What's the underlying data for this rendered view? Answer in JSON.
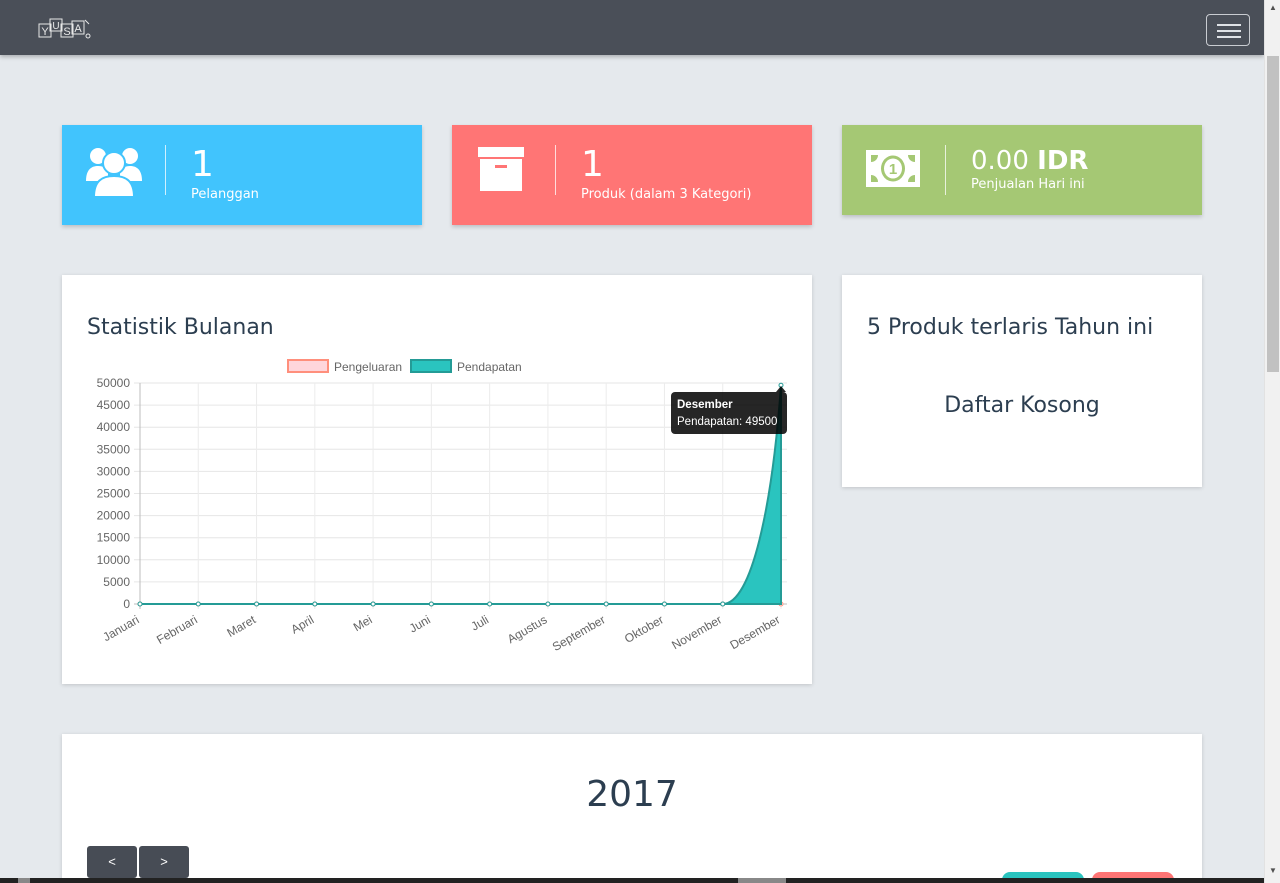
{
  "navbar": {
    "logo_letters": [
      "Y",
      "U",
      "S",
      "A"
    ]
  },
  "stats": [
    {
      "value": "1",
      "label": "Pelanggan",
      "icon": "users-icon",
      "color": "#41c4fd"
    },
    {
      "value": "1",
      "label": "Produk (dalam 3 Kategori)",
      "icon": "archive-box-icon",
      "color": "#ff7575"
    },
    {
      "value": "0.00",
      "currency": "IDR",
      "label": "Penjualan Hari ini",
      "icon": "money-bill-icon",
      "color": "#a5c874"
    }
  ],
  "monthly_panel": {
    "title": "Statistik Bulanan"
  },
  "top_products_panel": {
    "title": "5 Produk terlaris Tahun ini",
    "empty_text": "Daftar Kosong"
  },
  "calendar": {
    "year": "2017",
    "prev_label": "<",
    "next_label": ">"
  },
  "tooltip": {
    "title": "Desember",
    "body": "Pendapatan: 49500"
  },
  "chart_data": {
    "type": "line",
    "categories": [
      "Januari",
      "Februari",
      "Maret",
      "April",
      "Mei",
      "Juni",
      "Juli",
      "Agustus",
      "September",
      "Oktober",
      "November",
      "Desember"
    ],
    "series": [
      {
        "name": "Pengeluaran",
        "values": [
          0,
          0,
          0,
          0,
          0,
          0,
          0,
          0,
          0,
          0,
          0,
          0
        ],
        "color": "#ff8f7c",
        "fill": "#ffd6dc"
      },
      {
        "name": "Pendapatan",
        "values": [
          0,
          0,
          0,
          0,
          0,
          0,
          0,
          0,
          0,
          0,
          0,
          49500
        ],
        "color": "#249b96",
        "fill": "#2ac4bf"
      }
    ],
    "yticks": [
      "0",
      "5000",
      "10000",
      "15000",
      "20000",
      "25000",
      "30000",
      "35000",
      "40000",
      "45000",
      "50000"
    ],
    "ylim": [
      0,
      50000
    ],
    "legend": "top",
    "grid": true,
    "area": true
  }
}
